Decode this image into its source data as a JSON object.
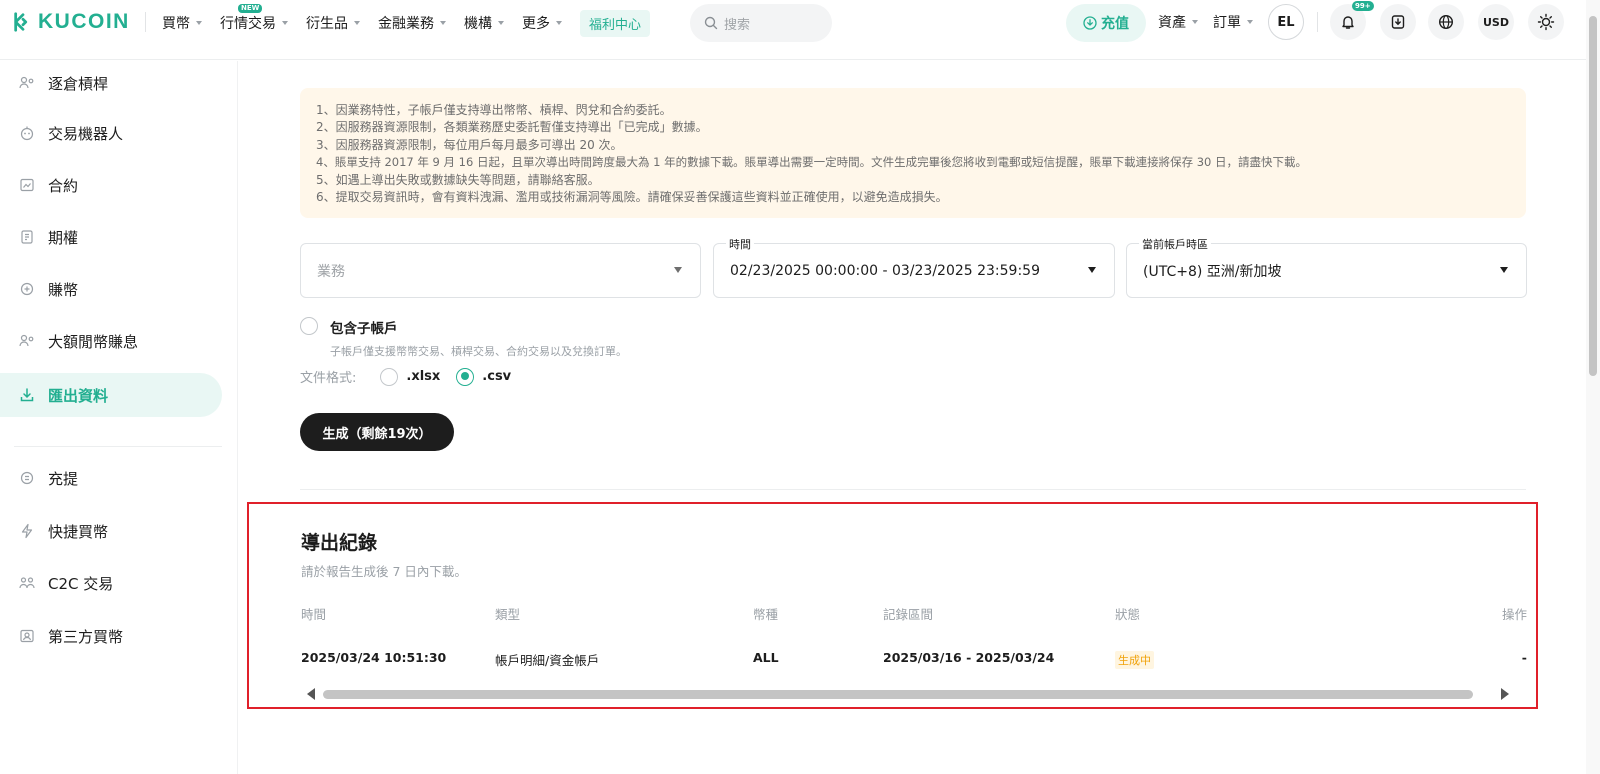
{
  "brand": {
    "name": "KUCOIN",
    "accent": "#23af91"
  },
  "nav": {
    "items": [
      {
        "label": "買幣",
        "caret": true
      },
      {
        "label": "行情",
        "badge": "NEW",
        "caret": false
      },
      {
        "label": "交易",
        "caret": true
      },
      {
        "label": "衍生品",
        "caret": true
      },
      {
        "label": "金融業務",
        "caret": true
      },
      {
        "label": "機構",
        "caret": true
      },
      {
        "label": "更多",
        "caret": true
      }
    ],
    "welfare": "福利中心"
  },
  "search": {
    "placeholder": "搜索"
  },
  "header": {
    "deposit": "充值",
    "assets": "資產",
    "orders": "訂單",
    "avatar": "EL",
    "notif_badge": "99+",
    "currency": "USD"
  },
  "sidebar": {
    "items": [
      {
        "label": "逐倉槓桿",
        "icon": "isolated-margin-icon"
      },
      {
        "label": "交易機器人",
        "icon": "bot-icon"
      },
      {
        "label": "合約",
        "icon": "futures-icon"
      },
      {
        "label": "期權",
        "icon": "options-icon"
      },
      {
        "label": "賺幣",
        "icon": "earn-icon"
      },
      {
        "label": "大額閒幣賺息",
        "icon": "lending-icon"
      },
      {
        "label": "匯出資料",
        "icon": "export-icon",
        "active": true
      },
      {
        "label": "充提",
        "icon": "deposit-withdraw-icon"
      },
      {
        "label": "快捷買幣",
        "icon": "fast-buy-icon"
      },
      {
        "label": "C2C 交易",
        "icon": "p2p-icon"
      },
      {
        "label": "第三方買幣",
        "icon": "third-party-icon"
      }
    ]
  },
  "notice": {
    "lines": [
      "1、因業務特性，子帳戶僅支持導出幣幣、槓桿、閃兌和合約委託。",
      "2、因服務器資源限制，各類業務歷史委託暫僅支持導出「已完成」數據。",
      "3、因服務器資源限制，每位用戶每月最多可導出 20 次。",
      "4、賬單支持 2017 年 9 月 16 日起，且單次導出時間跨度最大為 1 年的數據下載。賬單導出需要一定時間。文件生成完畢後您將收到電郵或短信提醒，賬單下載連接將保存 30 日，請盡快下載。",
      "5、如遇上導出失敗或數據缺失等問題，請聯絡客服。",
      "6、提取交易資訊時，會有資料洩漏、濫用或技術漏洞等風險。請確保妥善保護這些資料並正確使用，以避免造成損失。"
    ]
  },
  "form": {
    "business": {
      "placeholder": "業務"
    },
    "time": {
      "label": "時間",
      "value": "02/23/2025 00:00:00 - 03/23/2025 23:59:59"
    },
    "timezone": {
      "label": "當前帳戶時區",
      "value": "(UTC+8) 亞洲/新加坡"
    },
    "include_sub": {
      "label": "包含子帳戶",
      "hint": "子帳戶僅支援幣幣交易、槓桿交易、合約交易以及兌換訂單。",
      "checked": false
    },
    "format": {
      "label": "文件格式:",
      "options": [
        ".xlsx",
        ".csv"
      ],
      "selected": ".csv"
    },
    "generate": "生成（剩餘19次）"
  },
  "records": {
    "title": "導出紀錄",
    "subtitle": "請於報告生成後 7 日內下載。",
    "columns": [
      "時間",
      "類型",
      "幣種",
      "記錄區間",
      "狀態",
      "操作"
    ],
    "rows": [
      {
        "time": "2025/03/24 10:51:30",
        "type": "帳戶明細/資金帳戶",
        "currency": "ALL",
        "range": "2025/03/16 - 2025/03/24",
        "status": "生成中",
        "action": "-"
      }
    ]
  }
}
